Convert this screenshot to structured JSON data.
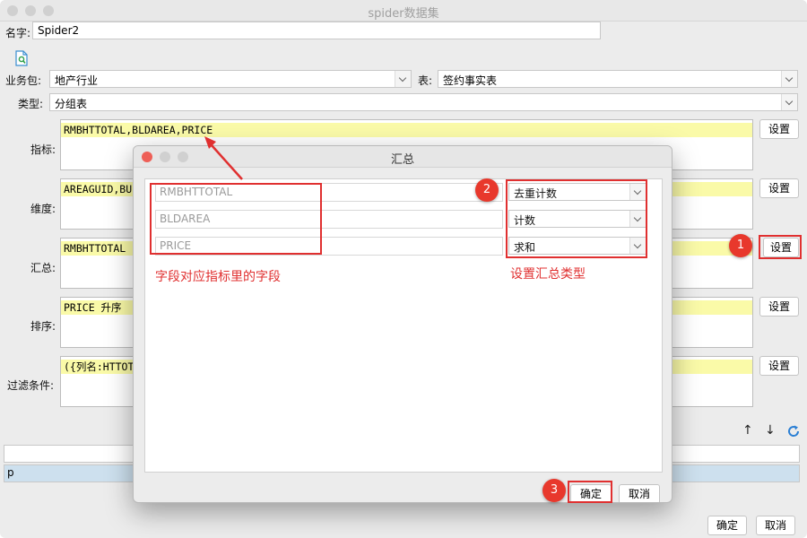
{
  "window": {
    "title": "spider数据集"
  },
  "form": {
    "name_label": "名字:",
    "name_value": "Spider2",
    "package_label": "业务包:",
    "package_value": "地产行业",
    "table_label": "表:",
    "table_value": "签约事实表",
    "type_label": "类型:",
    "type_value": "分组表",
    "rows": [
      {
        "label": "指标:",
        "content": "RMBHTTOTAL,BLDAREA,PRICE",
        "button": "设置"
      },
      {
        "label": "维度:",
        "content": "AREAGUID,BU",
        "button": "设置"
      },
      {
        "label": "汇总:",
        "content": "RMBHTTOTAL",
        "button": "设置"
      },
      {
        "label": "排序:",
        "content": "PRICE 升序",
        "button": "设置"
      },
      {
        "label": "过滤条件:",
        "content": "({列名:HTTOT",
        "button": "设置"
      }
    ],
    "bottom_row_text": "p",
    "ok": "确定",
    "cancel": "取消"
  },
  "toolbar_icons": [
    "document-search-icon",
    "arrow-up-icon",
    "arrow-down-icon",
    "refresh-icon"
  ],
  "dialog": {
    "title": "汇总",
    "fields": [
      {
        "name": "RMBHTTOTAL",
        "agg": "去重计数"
      },
      {
        "name": "BLDAREA",
        "agg": "计数"
      },
      {
        "name": "PRICE",
        "agg": "求和"
      }
    ],
    "ok": "确定",
    "cancel": "取消"
  },
  "annotations": {
    "badge1": "1",
    "badge2": "2",
    "badge3": "3",
    "field_note": "字段对应指标里的字段",
    "agg_note": "设置汇总类型"
  },
  "colors": {
    "highlight": "#fafaa8",
    "annotation_red": "#e03030",
    "selected_row": "#cde0ee"
  }
}
